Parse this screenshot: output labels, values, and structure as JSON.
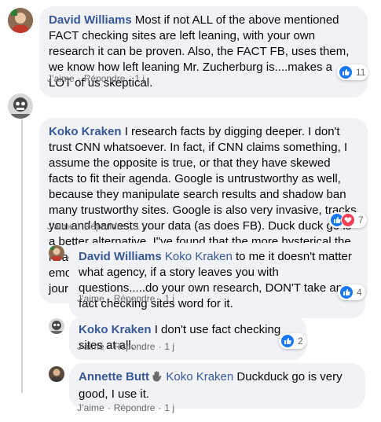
{
  "comments": [
    {
      "author": "David Williams",
      "mention": "",
      "text": "Most if not ALL of the above mentioned FACT checking sites are left leaning, with your own research it can be proven. Also, the FACT FB, uses them, we know how left leaning Mr. Zucherburg is....makes a LOT of us skeptical.",
      "like_label": "J’aime",
      "reply_label": "Répondre",
      "time": "1 j",
      "reaction_count": "11",
      "reactions": [
        "like-icon"
      ]
    },
    {
      "author": "Koko Kraken",
      "mention": "",
      "text": "I research facts by digging deeper. I don't trust CNN whatsoever. In fact, if CNN claims something, I assume the opposite is true, or that they have skewed facts to fit their agenda. Google is untrustworthy as well, because they manipulate search results and shadow ban many trustworthy sites. Google is also very invasive, tracks you and harvests your data (as does FB). Duck duck go is a better alternative. I\"ve found that the more hysterical the headline and the more it is intended to arouse an emotional response, the more fake it is. And yes, I studied journalism too.",
      "like_label": "J’aime",
      "reply_label": "Répondre",
      "time": "1 j",
      "reaction_count": "7",
      "reactions": [
        "like-icon",
        "love-icon"
      ]
    }
  ],
  "replies": [
    {
      "author": "David Williams",
      "mention": "Koko Kraken",
      "text": "to me it doesn't matter what agency, if a story leaves you with questions.....do your own research, DON'T take any fact checking sites word for it.",
      "like_label": "J’aime",
      "reply_label": "Répondre",
      "time": "1 j",
      "reaction_count": "4",
      "reactions": [
        "like-icon"
      ]
    },
    {
      "author": "Koko Kraken",
      "mention": "",
      "text": "I don't use fact checking sites at all.",
      "like_label": "J’aime",
      "reply_label": "Répondre",
      "time": "1 j",
      "reaction_count": "2",
      "reactions": [
        "like-icon"
      ]
    },
    {
      "author": "Annette Butt",
      "author_badge": "waving-hand-icon",
      "mention": "Koko Kraken",
      "text": "Duckduck go is very good, I use it.",
      "like_label": "J’aime",
      "reply_label": "Répondre",
      "time": "1 j",
      "reaction_count": "",
      "reactions": []
    }
  ],
  "colors": {
    "bubble_bg": "#f0f2f5",
    "name_link": "#385898",
    "meta_text": "#65676b",
    "like_blue": "#1877f2",
    "love_red": "#f33e58"
  }
}
